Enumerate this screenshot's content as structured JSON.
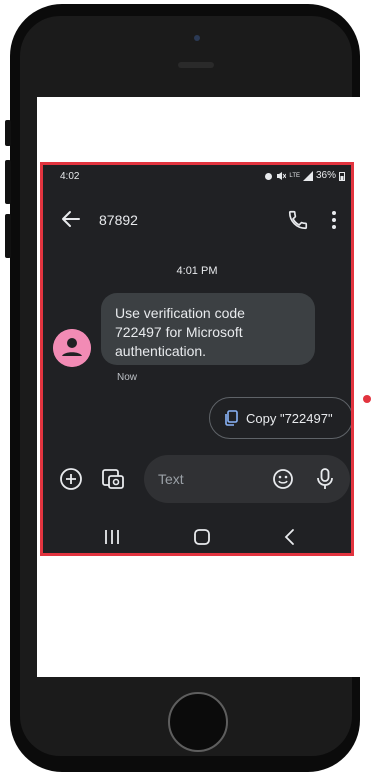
{
  "status_bar": {
    "time": "4:02",
    "battery": "36%",
    "icons": [
      "alarm-icon",
      "mute-icon",
      "lte-icon",
      "signal-icon",
      "battery-icon"
    ]
  },
  "header": {
    "contact": "87892",
    "icons": [
      "back-arrow-icon",
      "phone-call-icon",
      "more-vert-icon"
    ]
  },
  "conversation": {
    "timestamp": "4:01 PM",
    "message": {
      "line1": "Use verification code",
      "line2": "722497 for Microsoft",
      "line3": "authentication."
    },
    "message_time": "Now"
  },
  "suggestion": {
    "label": "Copy \"722497\""
  },
  "compose": {
    "placeholder": "Text",
    "icons": [
      "add-icon",
      "gallery-icon",
      "emoji-icon",
      "mic-icon"
    ]
  },
  "colors": {
    "app_bg": "#202124",
    "bubble": "#3c4043",
    "avatar": "#f28bb5",
    "highlight_border": "#e2343f",
    "compose_bg": "#303134"
  }
}
